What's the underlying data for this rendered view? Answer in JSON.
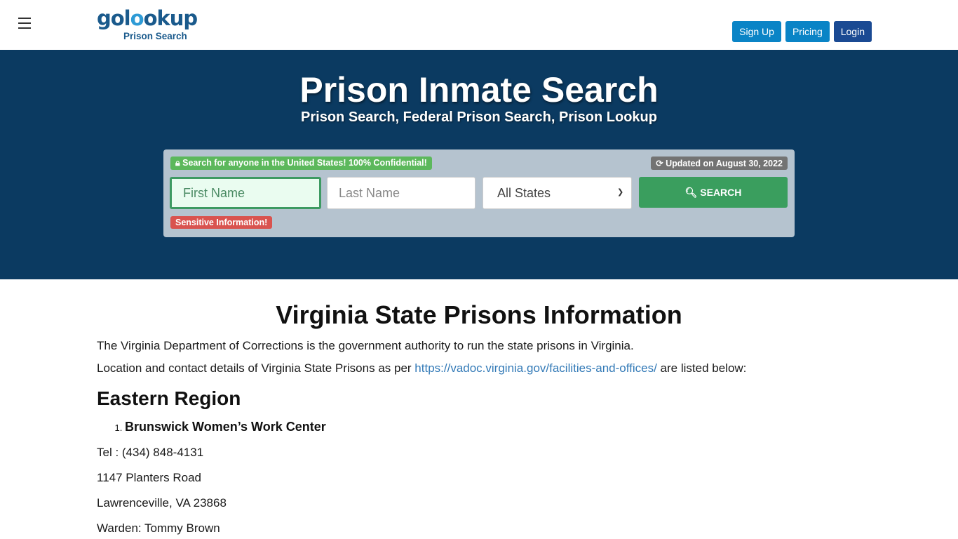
{
  "header": {
    "menu_icon": "hamburger-icon",
    "logo": {
      "brand_prefix": "gol",
      "brand_o1": "o",
      "brand_o2": "o",
      "brand_suffix": "kup",
      "tagline": "Prison Search"
    },
    "buttons": {
      "signup": "Sign Up",
      "pricing": "Pricing",
      "login": "Login"
    }
  },
  "hero": {
    "title": "Prison Inmate Search",
    "subtitle": "Prison Search, Federal Prison Search, Prison Lookup"
  },
  "search": {
    "confidential_badge": "Search for anyone in the United States! 100% Confidential!",
    "confidential_icon": "lock-icon",
    "updated_badge": "Updated on August 30, 2022",
    "updated_icon": "refresh-icon",
    "first_name_placeholder": "First Name",
    "first_name_value": "",
    "last_name_placeholder": "Last Name",
    "last_name_value": "",
    "state_selected": "All States",
    "search_button": "SEARCH",
    "search_icon": "search-icon",
    "sensitive_badge": "Sensitive Information!"
  },
  "main": {
    "title": "Virginia State Prisons Information",
    "intro": "The Virginia Department of Corrections is the government authority to run the state prisons in Virginia.",
    "source_prefix": "Location and contact details of Virginia State Prisons as per ",
    "source_link": "https://vadoc.virginia.gov/facilities-and-offices/",
    "source_suffix": " are listed below:",
    "region": "Eastern Region",
    "facilities": [
      {
        "name": "Brunswick Women’s Work Center",
        "tel": "Tel : (434) 848-4131",
        "address": "1147 Planters Road",
        "city": "Lawrenceville, VA 23868",
        "warden": "Warden: Tommy Brown"
      }
    ]
  }
}
